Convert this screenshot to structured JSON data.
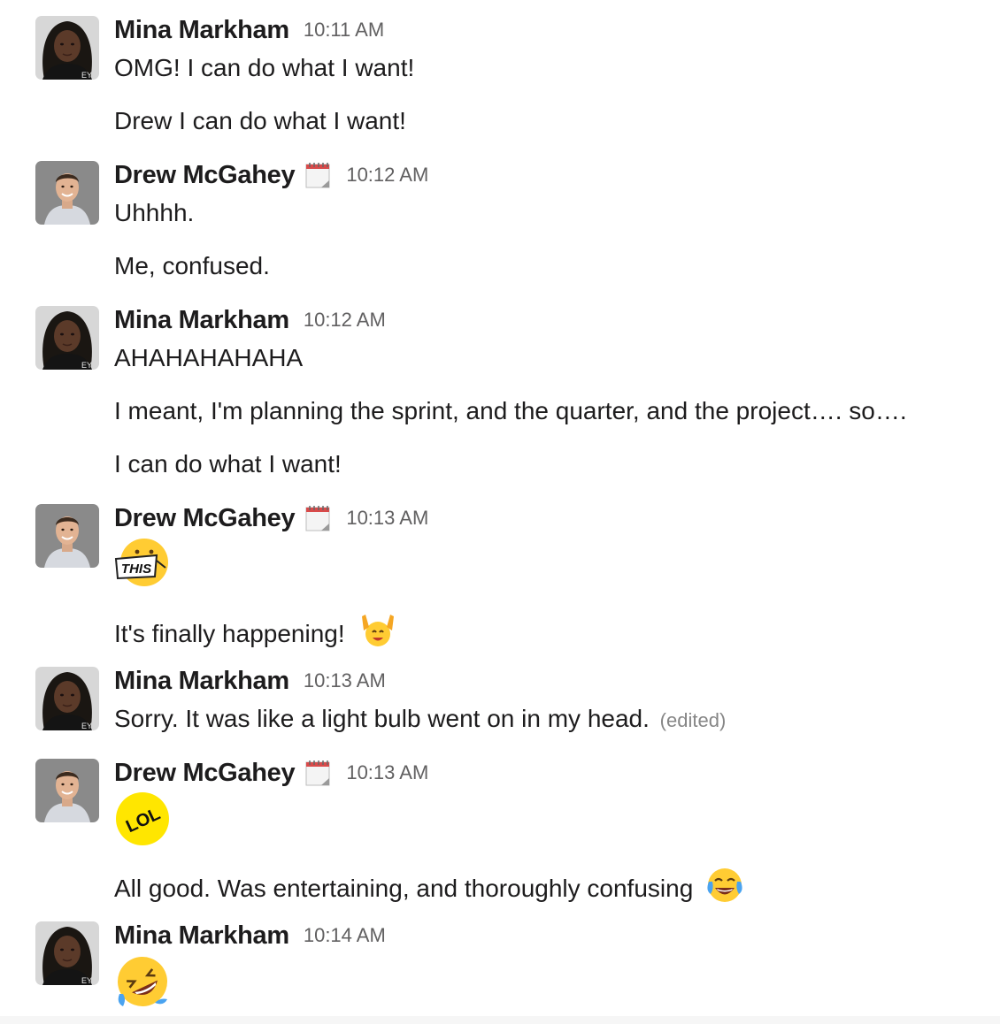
{
  "users": {
    "mina": {
      "name": "Mina Markham"
    },
    "drew": {
      "name": "Drew McGahey",
      "status_icon": "calendar-icon"
    }
  },
  "messages": [
    {
      "user": "Mina Markham",
      "time": "10:11 AM",
      "lines": [
        "OMG! I can do what I want!",
        "Drew I can do what I want!"
      ]
    },
    {
      "user": "Drew McGahey",
      "time": "10:12 AM",
      "lines": [
        "Uhhhh.",
        "Me, confused."
      ]
    },
    {
      "user": "Mina Markham",
      "time": "10:12 AM",
      "lines": [
        "AHAHAHAHAHA",
        "I meant, I'm planning the sprint, and the quarter, and the project…. so….",
        "I can do what I want!"
      ]
    },
    {
      "user": "Drew McGahey",
      "time": "10:13 AM",
      "emoji": "this-emoji",
      "emoji_text": "THIS",
      "lines": [
        "It's finally happening!"
      ],
      "inline_emoji": "raised-hands-emoji"
    },
    {
      "user": "Mina Markham",
      "time": "10:13 AM",
      "lines": [
        "Sorry. It was like a light bulb went on in my head."
      ],
      "edited_label": "(edited)"
    },
    {
      "user": "Drew McGahey",
      "time": "10:13 AM",
      "emoji": "lol-emoji",
      "emoji_text": "LOL",
      "lines": [
        "All good. Was entertaining, and thoroughly confusing"
      ],
      "inline_emoji": "joy-emoji"
    },
    {
      "user": "Mina Markham",
      "time": "10:14 AM",
      "emoji": "rofl-emoji"
    }
  ],
  "colors": {
    "text": "#1d1c1d",
    "timestamp": "#616061",
    "edited": "#868686",
    "emoji_yellow": "#ffcc33"
  }
}
